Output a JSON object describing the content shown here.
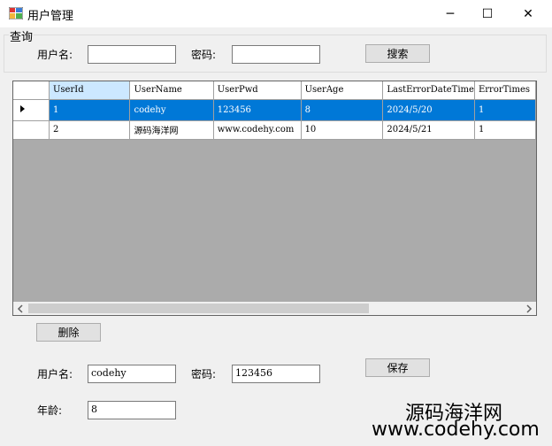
{
  "window": {
    "title": "用户管理",
    "minimize_glyph": "─",
    "maximize_glyph": "☐",
    "close_glyph": "✕"
  },
  "search_group": {
    "title": "查询",
    "username_label": "用户名:",
    "username_value": "",
    "password_label": "密码:",
    "password_value": "",
    "search_button": "搜索"
  },
  "grid": {
    "columns": [
      "UserId",
      "UserName",
      "UserPwd",
      "UserAge",
      "LastErrorDateTime",
      "ErrorTimes"
    ],
    "rows": [
      {
        "selected": true,
        "cells": [
          "1",
          "codehy",
          "123456",
          "8",
          "2024/5/20",
          "1"
        ]
      },
      {
        "selected": false,
        "cells": [
          "2",
          "源码海洋网",
          "www.codehy.com",
          "10",
          "2024/5/21",
          "1"
        ]
      }
    ]
  },
  "delete_button": "删除",
  "edit_form": {
    "username_label": "用户名:",
    "username_value": "codehy",
    "password_label": "密码:",
    "password_value": "123456",
    "age_label": "年龄:",
    "age_value": "8",
    "save_button": "保存"
  },
  "watermark": {
    "line1": "源码海洋网",
    "line2": "www.codehy.com"
  },
  "colors": {
    "selection": "#0078d7",
    "grid_background": "#ababab",
    "header_selected": "#cce8ff"
  }
}
